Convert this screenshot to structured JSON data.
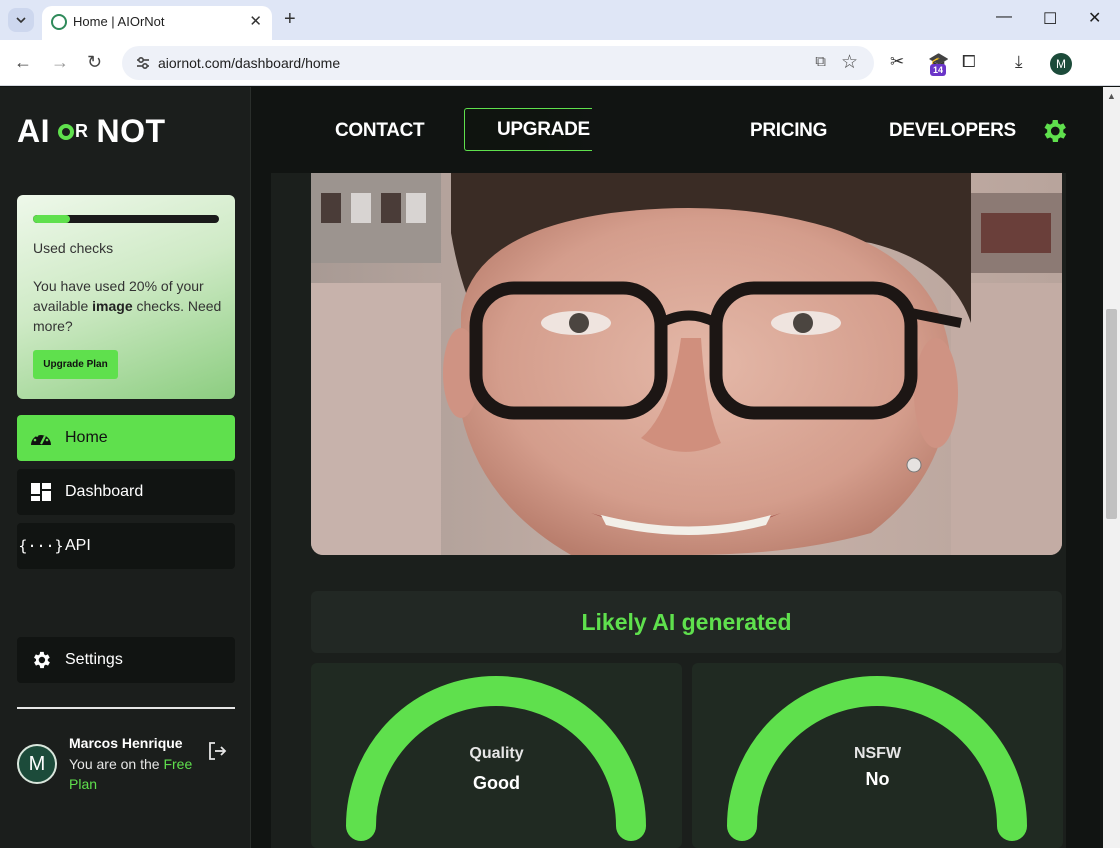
{
  "browser": {
    "tab_title": "Home | AIOrNot",
    "url": "aiornot.com/dashboard/home",
    "extension_badge": "14",
    "profile_initial": "M"
  },
  "sidebar": {
    "logo": {
      "left": "AI",
      "middle": "OR",
      "right": "NOT"
    },
    "checks_card": {
      "progress_fraction": 0.2,
      "title": "Used checks",
      "text_before": "You have used 20% of your available ",
      "text_bold": "image",
      "text_after": " checks. Need more?",
      "button": "Upgrade Plan"
    },
    "nav": [
      {
        "label": "Home",
        "icon": "dashboard-gauge-icon",
        "active": true
      },
      {
        "label": "Dashboard",
        "icon": "dashboard-grid-icon",
        "active": false
      },
      {
        "label": "API",
        "icon": "code-braces-icon",
        "active": false
      }
    ],
    "settings_label": "Settings",
    "user": {
      "initial": "M",
      "name": "Marcos Henrique",
      "plan_prefix": "You are on the ",
      "plan_name": "Free Plan"
    }
  },
  "topnav": {
    "contact": "CONTACT",
    "upgrade": "UPGRADE",
    "pricing": "PRICING",
    "developers": "DEVELOPERS"
  },
  "result": {
    "verdict": "Likely AI generated",
    "gauges": [
      {
        "label": "Quality",
        "value": "Good"
      },
      {
        "label": "NSFW",
        "value": "No"
      }
    ]
  },
  "colors": {
    "accent": "#5fe04d",
    "background": "#111412",
    "panel": "#1b1e1c"
  }
}
